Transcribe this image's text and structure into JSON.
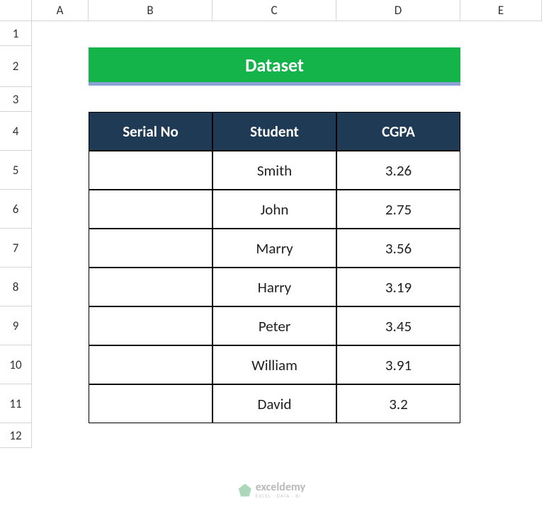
{
  "columns": [
    "A",
    "B",
    "C",
    "D",
    "E"
  ],
  "rows": [
    "1",
    "2",
    "3",
    "4",
    "5",
    "6",
    "7",
    "8",
    "9",
    "10",
    "11",
    "12"
  ],
  "title": "Dataset",
  "table": {
    "headers": [
      "Serial No",
      "Student",
      "CGPA"
    ],
    "data": [
      {
        "serial": "",
        "student": "Smith",
        "cgpa": "3.26"
      },
      {
        "serial": "",
        "student": "John",
        "cgpa": "2.75"
      },
      {
        "serial": "",
        "student": "Marry",
        "cgpa": "3.56"
      },
      {
        "serial": "",
        "student": "Harry",
        "cgpa": "3.19"
      },
      {
        "serial": "",
        "student": "Peter",
        "cgpa": "3.45"
      },
      {
        "serial": "",
        "student": "William",
        "cgpa": "3.91"
      },
      {
        "serial": "",
        "student": "David",
        "cgpa": "3.2"
      }
    ]
  },
  "watermark": {
    "main": "exceldemy",
    "sub": "EXCEL · DATA · BI"
  }
}
